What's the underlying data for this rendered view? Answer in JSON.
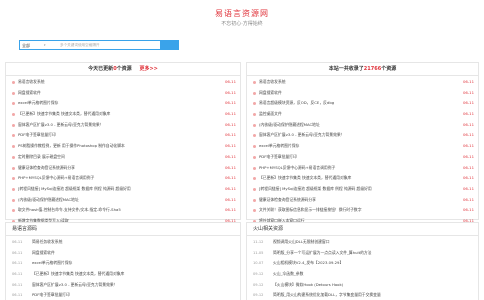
{
  "header": {
    "title": "易语言资源网",
    "subtitle": "不忘初心·方得始终"
  },
  "search": {
    "select_label": "全部",
    "placeholder": "多个关键词使用空格隔开"
  },
  "today_panel": {
    "prefix": "今天已更新",
    "count": "0",
    "suffix": "个资源",
    "more": "更多>>",
    "items": [
      {
        "title": "易语言收发系统",
        "date": "06-11"
      },
      {
        "title": "网盘搜索软件",
        "date": "06-11"
      },
      {
        "title": "excel单元格转图片保存",
        "date": "06-11"
      },
      {
        "title": "【已更新】快速字节集类 快速文本类，替代通用对象库",
        "date": "06-11"
      },
      {
        "title": "窗体客户区扩展v3.0 - 更新云母/亚克力背景效果！",
        "date": "06-11"
      },
      {
        "title": "PDF电子签章批量打印",
        "date": "06-11"
      },
      {
        "title": "PS树脂操作教程例，更新 用于操作Photoshop 制作自动化脚本",
        "date": "06-11"
      },
      {
        "title": "定时删除目录 展示磁盘空间",
        "date": "06-11"
      },
      {
        "title": "健康证体检查询登记系统源码分享",
        "date": "06-11"
      },
      {
        "title": "PHP+MYSQL反馈中心源码+易语言调用例子",
        "date": "06-11"
      },
      {
        "title": "[转程风链接] MySql连接池 超级框架 数据库 例程 纯源码 超级好用",
        "date": "06-11"
      },
      {
        "title": "(内核级)驱动保护隐藏进程MAC地址",
        "date": "06-11"
      },
      {
        "title": "取文件hash值-控制台命令-支持文件/文本-指定-命令行-Sha5",
        "date": "06-11"
      },
      {
        "title": "新增字节集数据类型写入/读取",
        "date": "06-11"
      }
    ]
  },
  "total_panel": {
    "prefix": "本站一共收录了",
    "count": "21766",
    "suffix": "个资源",
    "items": [
      {
        "title": "易语言收发系统",
        "date": "06-11"
      },
      {
        "title": "网盘搜索软件",
        "date": "06-11"
      },
      {
        "title": "易语言超级模块资源，反OD，反CE，反dbg",
        "date": "06-11"
      },
      {
        "title": "监控桌面文件",
        "date": "06-11"
      },
      {
        "title": "(内核级)驱动保护隐藏进程MAC地址",
        "date": "06-11"
      },
      {
        "title": "窗体客户区扩展v3.0 - 更新云母/亚克力背景效果！",
        "date": "06-11"
      },
      {
        "title": "excel单元格转图片保存",
        "date": "06-11"
      },
      {
        "title": "PDF电子签章批量打印",
        "date": "06-11"
      },
      {
        "title": "PHP+MYSQL反馈中心源码+易语言调用例子",
        "date": "06-11"
      },
      {
        "title": "【已更新】快速字节集类 快速文本类，替代通用对象库",
        "date": "06-11"
      },
      {
        "title": "[转程风链接] MySql连接池 超级框架 数据库 例程 纯源码 超级好用",
        "date": "06-11"
      },
      {
        "title": "健康证体检查询登记系统源码分享",
        "date": "06-11"
      },
      {
        "title": "文件关联！获取图标信息和显示一排链接按钮！换行时子数字",
        "date": "06-11"
      },
      {
        "title": "将外部窗口嵌入本窗口运行",
        "date": "06-11"
      }
    ]
  },
  "bottom_left": {
    "title": "易语言源码",
    "items": [
      {
        "date": "06-11",
        "title": "简易任务收发系统"
      },
      {
        "date": "06-11",
        "title": "网盘搜索软件"
      },
      {
        "date": "06-11",
        "title": "excel单元格转图片保存"
      },
      {
        "date": "06-11",
        "title": "【已更新】快速字节集类 快速文本类，替代通用对象库"
      },
      {
        "date": "06-11",
        "title": "窗体客户区扩展v3.0 - 更新云母/亚克力背景效果！"
      },
      {
        "date": "06-11",
        "title": "PDF电子签章批量打印"
      }
    ]
  },
  "bottom_right": {
    "title": "火山相关资源",
    "items": [
      {
        "date": "11-12",
        "title": "视频调用火山DLL无限制创建窗口"
      },
      {
        "date": "11-05",
        "title": "简明版_分享一个写运扩展为一点点读入文件_算hult的方法"
      },
      {
        "date": "10-07",
        "title": "火山相机模块V2.4_发布【2023.09.29】"
      },
      {
        "date": "09-12",
        "title": "火山_伞函数_参数"
      },
      {
        "date": "09-12",
        "title": "【火山模块】微软Hook (Detours Hook)"
      },
      {
        "date": "09-12",
        "title": "简明版_用火山构建系统优化加载DLL，字节集变量用于交换变量"
      }
    ]
  }
}
